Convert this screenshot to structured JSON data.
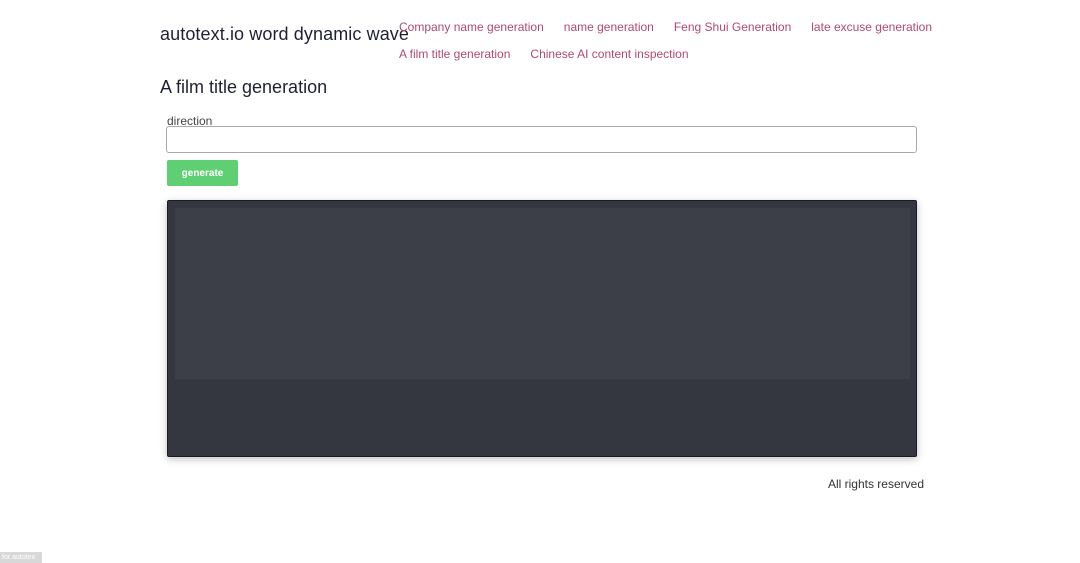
{
  "header": {
    "brand": "autotext.io word dynamic wave",
    "nav": {
      "row1": [
        "Company name generation",
        "name generation",
        "Feng Shui Generation",
        "late excuse generation"
      ],
      "row2": [
        "A film title generation",
        "Chinese AI content inspection"
      ]
    }
  },
  "main": {
    "title": "A film title generation",
    "field_label": "direction",
    "field_value": "",
    "generate_label": "generate"
  },
  "footer": {
    "text": "All rights reserved"
  },
  "badge": {
    "text": "for autotex"
  },
  "colors": {
    "link": "#b24a69",
    "button": "#5fcf73",
    "panel": "#343740"
  }
}
